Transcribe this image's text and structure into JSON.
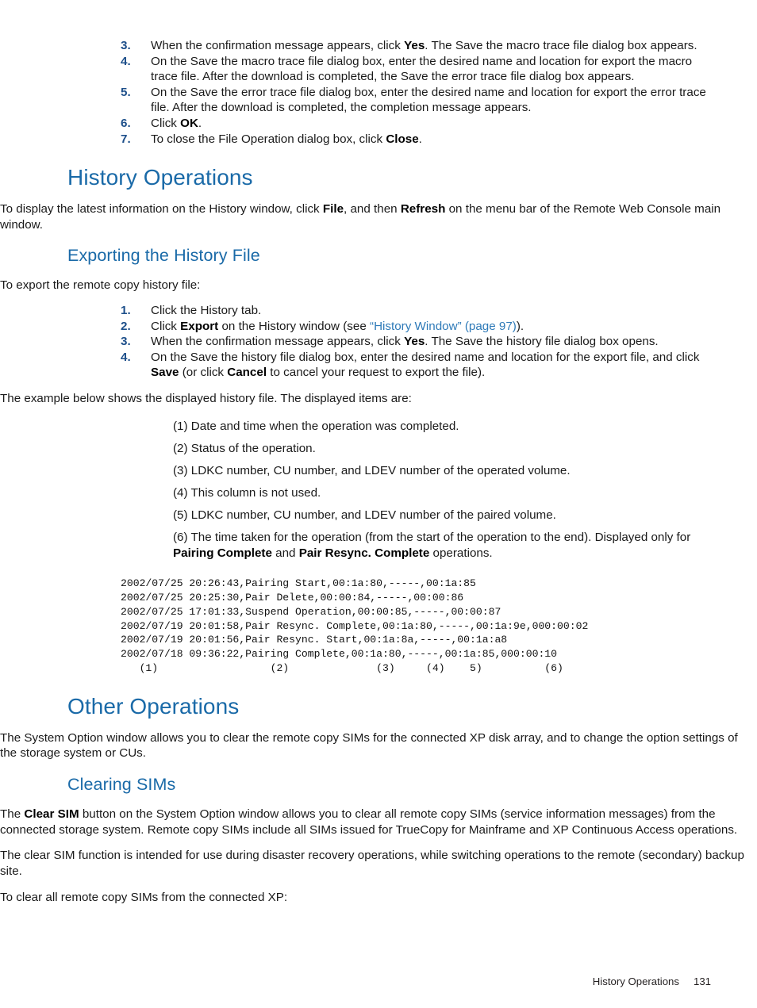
{
  "document": {
    "page_number": "131",
    "footer_title": "History Operations",
    "accent_heading_color": "#1a6aa8",
    "accent_number_color": "#1d4f8a",
    "link_color": "#2e7ab8"
  },
  "top_steps": {
    "items": [
      {
        "num": "3.",
        "parts": [
          {
            "t": "When the confirmation message appears, click ",
            "b": false
          },
          {
            "t": "Yes",
            "b": true
          },
          {
            "t": ". The Save the macro trace file dialog box appears.",
            "b": false
          }
        ]
      },
      {
        "num": "4.",
        "parts": [
          {
            "t": "On the Save the macro trace file dialog box, enter the desired name and location for export the macro trace file. After the download is completed, the Save the error trace file dialog box appears.",
            "b": false
          }
        ]
      },
      {
        "num": "5.",
        "parts": [
          {
            "t": "On the Save the error trace file dialog box, enter the desired name and location for export the error trace file. After the download is completed, the completion message appears.",
            "b": false
          }
        ]
      },
      {
        "num": "6.",
        "parts": [
          {
            "t": "Click ",
            "b": false
          },
          {
            "t": "OK",
            "b": true
          },
          {
            "t": ".",
            "b": false
          }
        ]
      },
      {
        "num": "7.",
        "parts": [
          {
            "t": "To close the File Operation dialog box, click ",
            "b": false
          },
          {
            "t": "Close",
            "b": true
          },
          {
            "t": ".",
            "b": false
          }
        ]
      }
    ]
  },
  "history_operations": {
    "heading": "History Operations",
    "intro_parts": [
      {
        "t": "To display the latest information on the History window, click ",
        "b": false
      },
      {
        "t": "File",
        "b": true
      },
      {
        "t": ", and then ",
        "b": false
      },
      {
        "t": "Refresh",
        "b": true
      },
      {
        "t": " on the menu bar of the Remote Web Console main window.",
        "b": false
      }
    ]
  },
  "exporting_history_file": {
    "heading": "Exporting the History File",
    "lead": "To export the remote copy history file:",
    "steps": [
      {
        "num": "1.",
        "parts": [
          {
            "t": "Click the History tab.",
            "b": false
          }
        ]
      },
      {
        "num": "2.",
        "parts": [
          {
            "t": "Click ",
            "b": false
          },
          {
            "t": "Export",
            "b": true
          },
          {
            "t": " on the History window (see ",
            "b": false
          },
          {
            "t": "“History Window” (page 97)",
            "b": false,
            "link": true
          },
          {
            "t": ").",
            "b": false
          }
        ]
      },
      {
        "num": "3.",
        "parts": [
          {
            "t": "When the confirmation message appears, click ",
            "b": false
          },
          {
            "t": "Yes",
            "b": true
          },
          {
            "t": ". The Save the history file dialog box opens.",
            "b": false
          }
        ]
      },
      {
        "num": "4.",
        "parts": [
          {
            "t": "On the Save the history file dialog box, enter the desired name and location for the export file, and click ",
            "b": false
          },
          {
            "t": "Save",
            "b": true
          },
          {
            "t": " (or click ",
            "b": false
          },
          {
            "t": "Cancel",
            "b": true
          },
          {
            "t": " to cancel your request to export the file).",
            "b": false
          }
        ]
      }
    ],
    "example_intro": "The example below shows the displayed history file. The displayed items are:",
    "column_descriptions": [
      {
        "parts": [
          {
            "t": "(1) Date and time when the operation was completed.",
            "b": false
          }
        ]
      },
      {
        "parts": [
          {
            "t": "(2) Status of the operation.",
            "b": false
          }
        ]
      },
      {
        "parts": [
          {
            "t": "(3) LDKC number, CU number, and LDEV number of the operated volume.",
            "b": false
          }
        ]
      },
      {
        "parts": [
          {
            "t": "(4) This column is not used.",
            "b": false
          }
        ]
      },
      {
        "parts": [
          {
            "t": "(5) LDKC number, CU number, and LDEV number of the paired volume.",
            "b": false
          }
        ]
      },
      {
        "parts": [
          {
            "t": "(6) The time taken for the operation (from the start of the operation to the end). Displayed only for ",
            "b": false
          },
          {
            "t": "Pairing Complete",
            "b": true
          },
          {
            "t": " and ",
            "b": false
          },
          {
            "t": "Pair Resync. Complete",
            "b": true
          },
          {
            "t": " operations.",
            "b": false
          }
        ]
      }
    ],
    "code_sample": "2002/07/25 20:26:43,Pairing Start,00:1a:80,-----,00:1a:85\n2002/07/25 20:25:30,Pair Delete,00:00:84,-----,00:00:86\n2002/07/25 17:01:33,Suspend Operation,00:00:85,-----,00:00:87\n2002/07/19 20:01:58,Pair Resync. Complete,00:1a:80,-----,00:1a:9e,000:00:02\n2002/07/19 20:01:56,Pair Resync. Start,00:1a:8a,-----,00:1a:a8\n2002/07/18 09:36:22,Pairing Complete,00:1a:80,-----,00:1a:85,000:00:10\n   (1)                  (2)              (3)     (4)    5)          (6)"
  },
  "other_operations": {
    "heading": "Other Operations",
    "intro": "The System Option window allows you to clear the remote copy SIMs for the connected XP disk array, and to change the option settings of the storage system or CUs."
  },
  "clearing_sims": {
    "heading": "Clearing SIMs",
    "paragraph1_parts": [
      {
        "t": "The ",
        "b": false
      },
      {
        "t": "Clear SIM",
        "b": true
      },
      {
        "t": " button on the System Option window allows you to clear all remote copy SIMs (service information messages) from the connected storage system. Remote copy SIMs include all SIMs issued for TrueCopy for Mainframe and XP Continuous Access operations.",
        "b": false
      }
    ],
    "paragraph2": "The clear SIM function is intended for use during disaster recovery operations, while switching operations to the remote (secondary) backup site.",
    "paragraph3": "To clear all remote copy SIMs from the connected XP:"
  }
}
